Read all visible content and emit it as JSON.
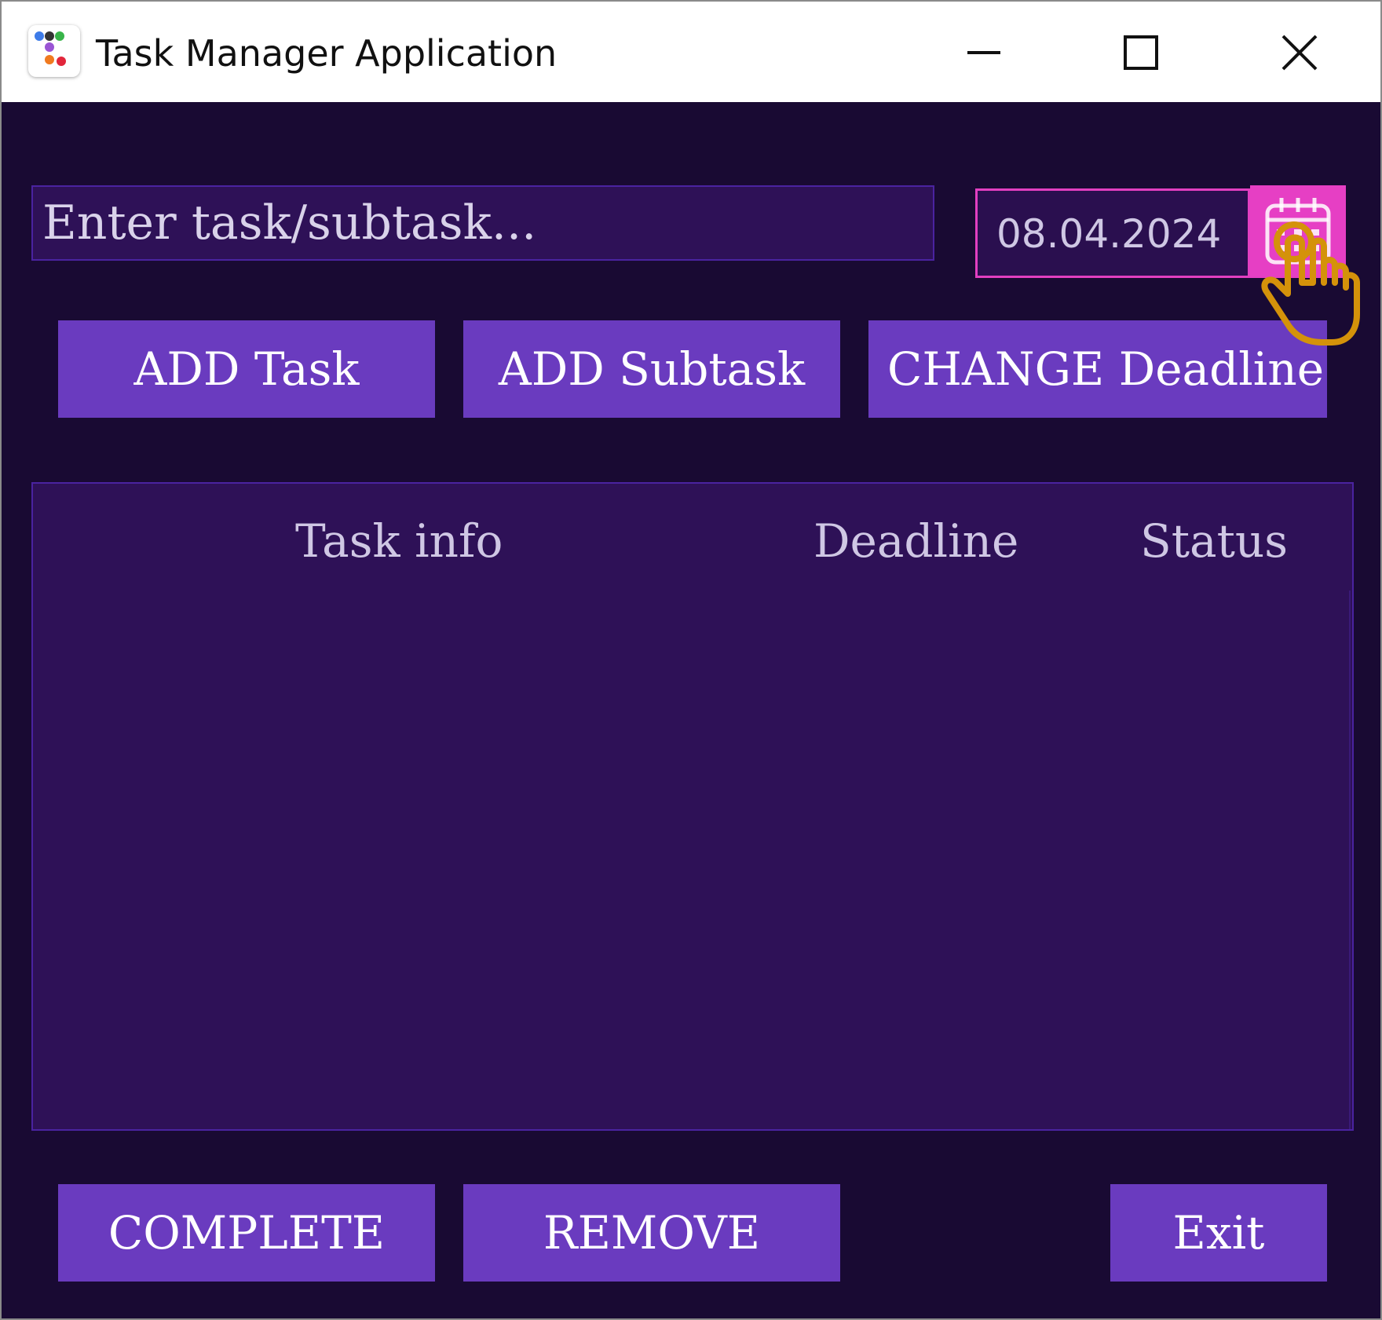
{
  "window": {
    "title": "Task Manager Application",
    "controls": {
      "minimize": "minimize-icon",
      "maximize": "maximize-icon",
      "close": "close-icon"
    }
  },
  "form": {
    "task_placeholder": "Enter task/subtask...",
    "task_value": "",
    "date_value": "08.04.2024",
    "calendar_icon": "calendar-icon"
  },
  "actions": {
    "add_task": "ADD Task",
    "add_subtask": "ADD Subtask",
    "change_deadline": "CHANGE Deadline"
  },
  "table": {
    "columns": [
      "Task info",
      "Deadline",
      "Status"
    ],
    "rows": []
  },
  "footer": {
    "complete": "COMPLETE",
    "remove": "REMOVE",
    "exit": "Exit"
  },
  "colors": {
    "background": "#190a33",
    "panel": "#2e1157",
    "button": "#6a3bbf",
    "accent": "#e63fc4",
    "cursor": "#d4920a"
  }
}
